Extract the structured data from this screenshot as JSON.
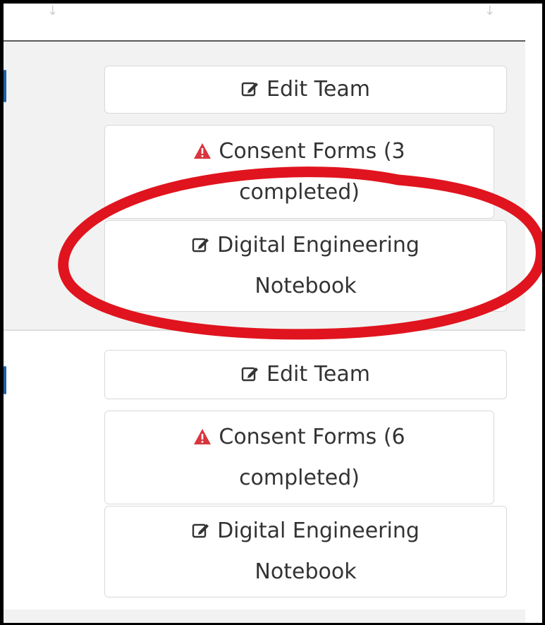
{
  "table": {
    "rows": [
      {
        "edit_team_label": "Edit Team",
        "consent_line1": "Consent Forms (3",
        "consent_line2": "completed)",
        "notebook_line1": "Digital Engineering",
        "notebook_line2": "Notebook"
      },
      {
        "edit_team_label": "Edit Team",
        "consent_line1": "Consent Forms (6",
        "consent_line2": "completed)",
        "notebook_line1": "Digital Engineering",
        "notebook_line2": "Notebook"
      }
    ]
  },
  "colors": {
    "warning_icon": "#d9353e",
    "highlight_ring": "#e0141e",
    "row_shade": "#f2f2f2",
    "button_text": "#333333"
  },
  "icons": {
    "edit": "edit-icon",
    "warning": "warning-icon",
    "sort": "sort-icon"
  }
}
